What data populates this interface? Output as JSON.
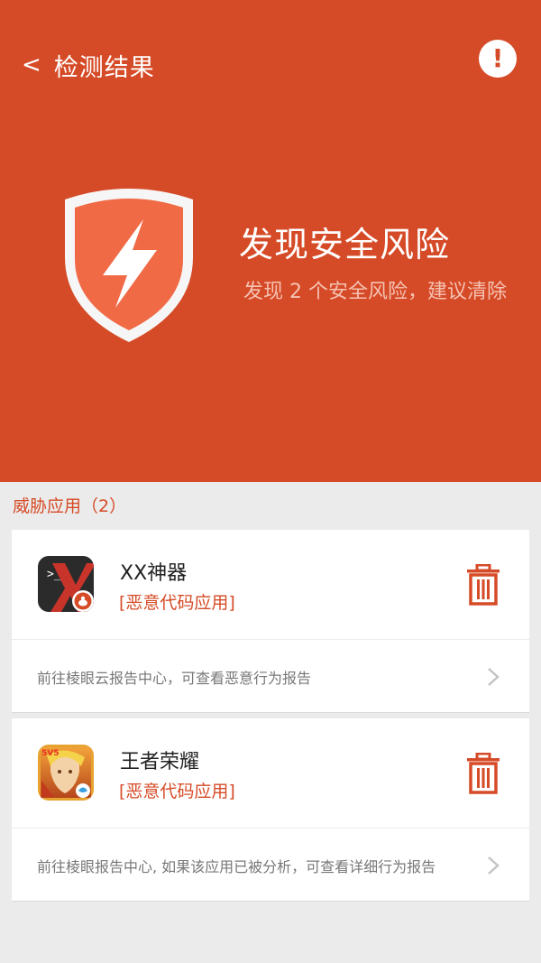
{
  "header": {
    "back_arrow": "<",
    "title": "检测结果",
    "alert_mark": "!",
    "risk_title": "发现安全风险",
    "risk_subtitle": "发现 2 个安全风险，建议清除"
  },
  "section": {
    "label": "威胁应用（2）"
  },
  "apps": [
    {
      "name": "XX神器",
      "tag": "[恶意代码应用]",
      "report_link": "前往棱眼云报告中心，可查看恶意行为报告",
      "icon": "xx-app-icon"
    },
    {
      "name": "王者荣耀",
      "tag": "[恶意代码应用]",
      "report_link": "前往棱眼报告中心, 如果该应用已被分析，可查看详细行为报告",
      "icon": "king-glory-app-icon",
      "icon_badge": "5V5"
    }
  ],
  "colors": {
    "primary": "#d64b27",
    "shield": "#f06a45",
    "background": "#ebebeb"
  }
}
